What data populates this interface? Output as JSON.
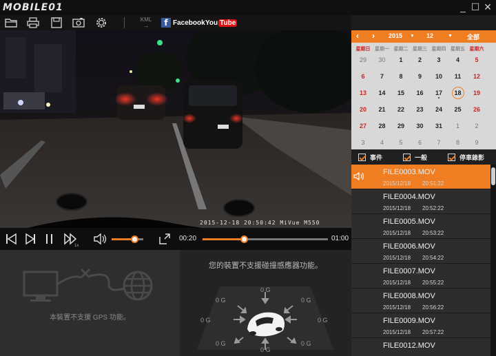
{
  "titlebar": {
    "logo": "MOBILE01",
    "minimize": "_",
    "maximize": "☐",
    "close": "✕"
  },
  "toolbar": {
    "icons": [
      "folder-icon",
      "print-icon",
      "save-icon",
      "snapshot-icon",
      "settings-icon"
    ],
    "kml_label": "KML",
    "facebook_label": "Facebook",
    "youtube_you": "You",
    "youtube_tube": "Tube"
  },
  "video": {
    "timestamp": "2015-12-18  20:50:42    MiVue M550"
  },
  "controls": {
    "speed_label": "1x",
    "volume_level": 0.72,
    "current_time": "00:20",
    "total_time": "01:00",
    "progress": 0.33
  },
  "gps": {
    "message": "本裝置不支援 GPS 功能。"
  },
  "gsensor": {
    "message": "您的裝置不支援碰撞感應器功能。",
    "values": [
      "0 G",
      "0 G",
      "0 G",
      "0 G",
      "0 G",
      "0 G",
      "0 G",
      "0 G"
    ]
  },
  "calendar": {
    "prev": "‹",
    "next": "›",
    "year": "2015",
    "month": "12",
    "all_label": "全部",
    "weekdays": [
      "星期日",
      "星期一",
      "星期二",
      "星期三",
      "星期四",
      "星期五",
      "星期六"
    ],
    "weeks": [
      [
        "29",
        "30",
        "1",
        "2",
        "3",
        "4",
        "5"
      ],
      [
        "6",
        "7",
        "8",
        "9",
        "10",
        "11",
        "12"
      ],
      [
        "13",
        "14",
        "15",
        "16",
        "17",
        "18",
        "19"
      ],
      [
        "20",
        "21",
        "22",
        "23",
        "24",
        "25",
        "26"
      ],
      [
        "27",
        "28",
        "29",
        "30",
        "31",
        "1",
        "2"
      ],
      [
        "3",
        "4",
        "5",
        "6",
        "7",
        "8",
        "9"
      ]
    ],
    "selected_day": "18",
    "days_with_events": [
      "17"
    ]
  },
  "filters": {
    "event": "事件",
    "normal": "一般",
    "parking": "停車錄影"
  },
  "files": [
    {
      "name": "FILE0003.MOV",
      "date": "2015/12/18",
      "time": "20:51:22",
      "selected": true
    },
    {
      "name": "FILE0004.MOV",
      "date": "2015/12/18",
      "time": "20:52:22"
    },
    {
      "name": "FILE0005.MOV",
      "date": "2015/12/18",
      "time": "20:53:22"
    },
    {
      "name": "FILE0006.MOV",
      "date": "2015/12/18",
      "time": "20:54:22"
    },
    {
      "name": "FILE0007.MOV",
      "date": "2015/12/18",
      "time": "20:55:22"
    },
    {
      "name": "FILE0008.MOV",
      "date": "2015/12/18",
      "time": "20:56:22"
    },
    {
      "name": "FILE0009.MOV",
      "date": "2015/12/18",
      "time": "20:57:22"
    },
    {
      "name": "FILE0012.MOV",
      "date": "",
      "time": ""
    }
  ],
  "colors": {
    "accent": "#ef7d22",
    "weekend": "#cc2222"
  }
}
